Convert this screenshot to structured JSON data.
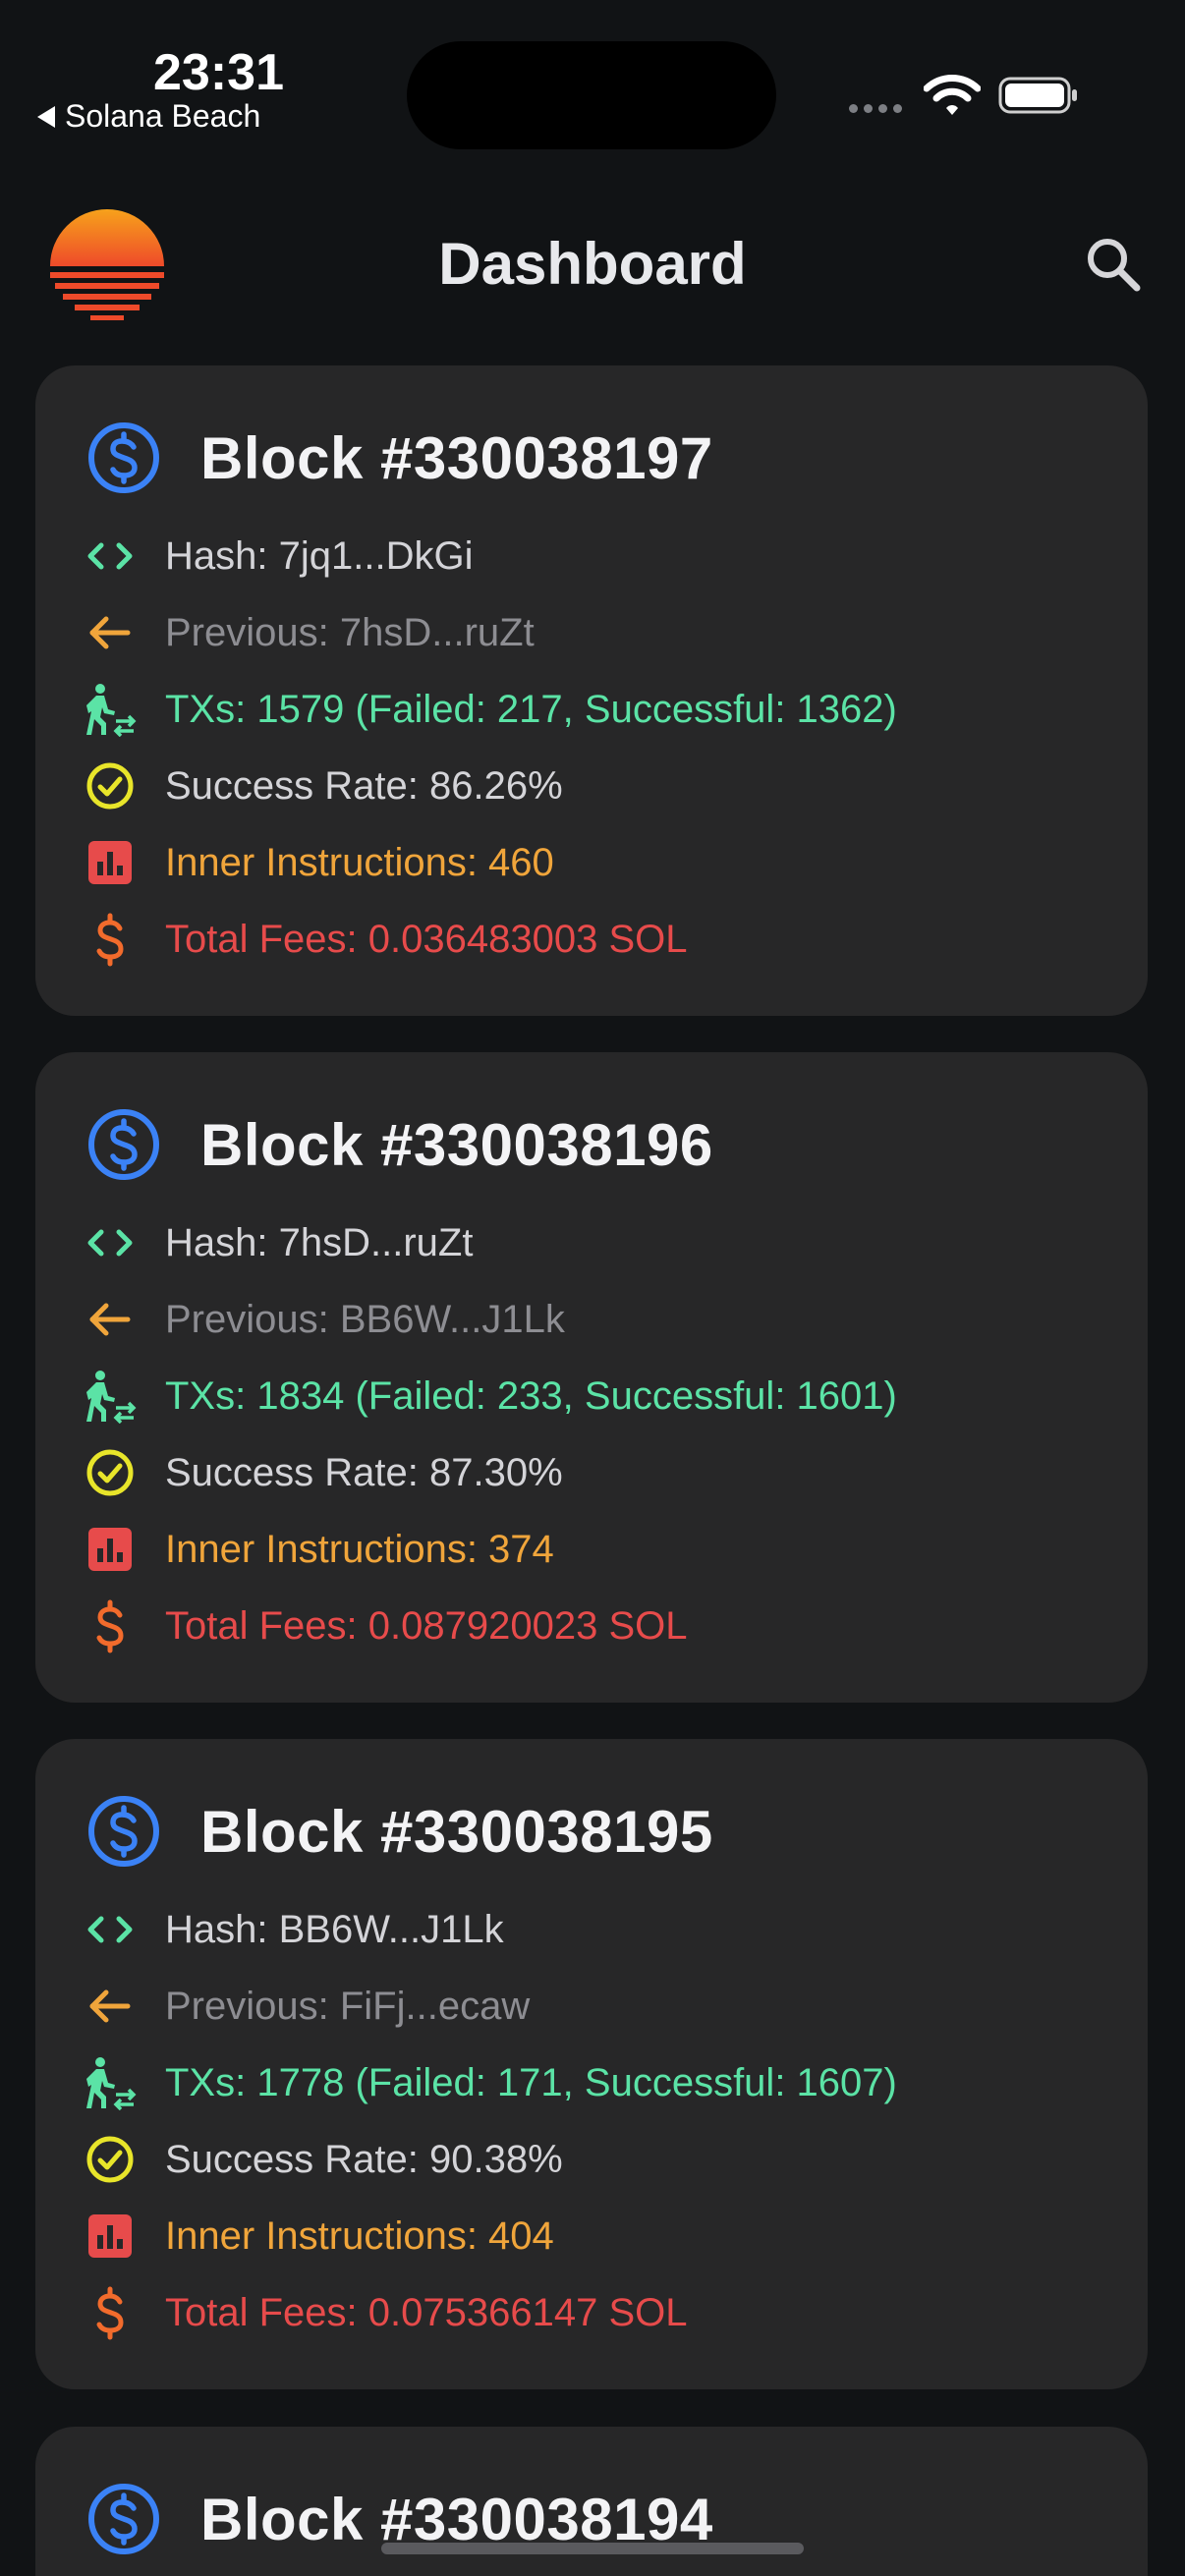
{
  "status_bar": {
    "time": "23:31",
    "back_app": "Solana Beach",
    "icons": [
      "cellular-signal-icon",
      "wifi-icon",
      "battery-icon"
    ]
  },
  "header": {
    "title": "Dashboard",
    "logo_icon": "sunset-logo-icon",
    "search_icon": "search-icon"
  },
  "colors": {
    "background": "#111315",
    "card": "#272728",
    "hash": "#5be3a6",
    "previous": "#f0a53b",
    "txs": "#5be3a6",
    "success_rate": "#e8e52a",
    "inner": "#e74b4b",
    "fees": "#e74b4b",
    "coin": "#3b82f6"
  },
  "blocks": [
    {
      "title": "Block #330038197",
      "hash": "Hash: 7jq1...DkGi",
      "previous": "Previous: 7hsD...ruZt",
      "txs": "TXs: 1579 (Failed: 217, Successful: 1362)",
      "success_rate": "Success Rate: 86.26%",
      "inner": "Inner Instructions: 460",
      "fees": "Total Fees: 0.036483003 SOL"
    },
    {
      "title": "Block #330038196",
      "hash": "Hash: 7hsD...ruZt",
      "previous": "Previous: BB6W...J1Lk",
      "txs": "TXs: 1834 (Failed: 233, Successful: 1601)",
      "success_rate": "Success Rate: 87.30%",
      "inner": "Inner Instructions: 374",
      "fees": "Total Fees: 0.087920023 SOL"
    },
    {
      "title": "Block #330038195",
      "hash": "Hash: BB6W...J1Lk",
      "previous": "Previous: FiFj...ecaw",
      "txs": "TXs: 1778 (Failed: 171, Successful: 1607)",
      "success_rate": "Success Rate: 90.38%",
      "inner": "Inner Instructions: 404",
      "fees": "Total Fees: 0.075366147 SOL"
    },
    {
      "title": "Block #330038194"
    }
  ]
}
